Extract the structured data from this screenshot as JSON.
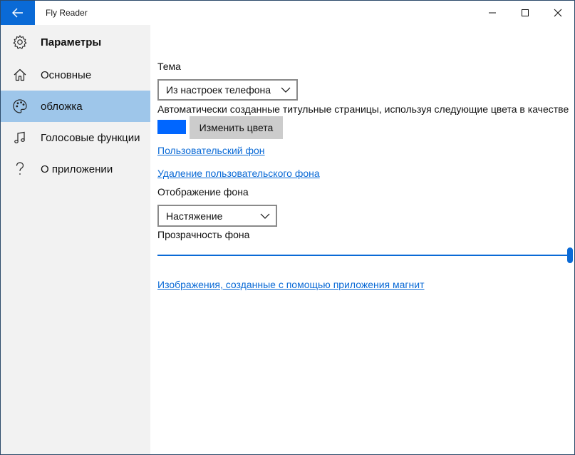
{
  "window": {
    "app_title": "Fly Reader"
  },
  "sidebar": {
    "header": {
      "label": "Параметры",
      "icon": "gear-icon"
    },
    "items": [
      {
        "label": "Основные",
        "icon": "home-icon"
      },
      {
        "label": "обложка",
        "icon": "palette-icon",
        "selected": true
      },
      {
        "label": "Голосовые функции",
        "icon": "music-note-icon"
      },
      {
        "label": "О приложении",
        "icon": "question-mark-icon"
      }
    ]
  },
  "content": {
    "theme_label": "Тема",
    "theme_value": "Из настроек телефона",
    "auto_pages_text": "Автоматически созданные титульные страницы, используя следующие цвета в качестве",
    "color_swatch": "#0066ff",
    "change_colors_button": "Изменить цвета",
    "custom_bg_link": "Пользовательский фон",
    "remove_custom_bg_link": "Удаление пользовательского фона",
    "bg_display_label": "Отображение фона",
    "bg_display_value": "Настяжение",
    "bg_transparency_label": "Прозрачность фона",
    "bg_transparency_value": 1.0,
    "magnet_images_link": "Изображения, созданные с помощью приложения магнит"
  },
  "colors": {
    "accent": "#0a6ad6",
    "selected_nav": "#9ec6ea",
    "sidebar_bg": "#f2f2f2"
  }
}
